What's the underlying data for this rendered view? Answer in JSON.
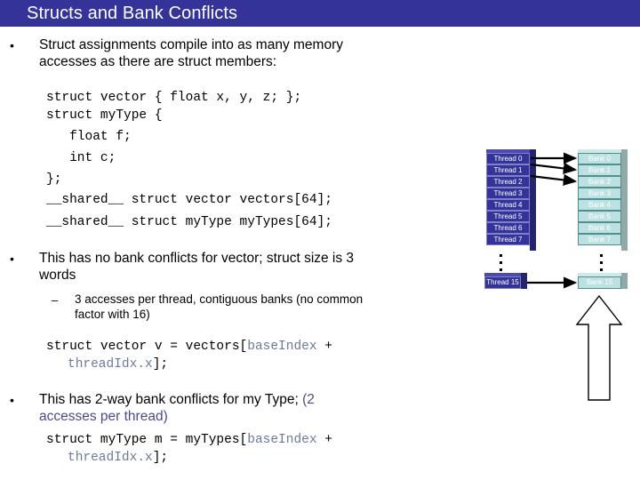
{
  "slide": {
    "title": "Structs and Bank Conflicts",
    "title_bg": "#333399",
    "title_color": "#ffffff",
    "background": "#ffffff"
  },
  "bullets": [
    {
      "marker": "•",
      "line1": "Struct assignments compile into as many memory",
      "line2": "accesses as there are struct members:"
    },
    {
      "marker": "•",
      "line1": "This has no bank conflicts for vector; struct size is 3",
      "line2": "words"
    },
    {
      "marker": "•",
      "line1_black": "This has 2-way bank conflicts for my Type; ",
      "line1_accent": "(2",
      "line2_accent": "accesses per thread)"
    }
  ],
  "sub_bullet": {
    "marker": "–",
    "line1": "3 accesses per thread, contiguous banks (no common",
    "line2": "factor with 16)"
  },
  "code_blocks": {
    "block1": {
      "line1": "struct vector { float x, y, z; };",
      "line2": "struct myType {",
      "line3": "   float f;",
      "line4": "   int c;",
      "line5": "};",
      "line6": "__shared__ struct vector vectors[64];",
      "line7": "__shared__ struct myType myTypes[64];"
    },
    "block2": {
      "line1_pre": "struct vector v = vectors[",
      "line1_var": "baseIndex",
      "line1_post": " +",
      "line2_var": "threadIdx.x",
      "line2_post": "];"
    },
    "block3": {
      "line1_pre": "struct myType m = myTypes[",
      "line1_var": "baseIndex",
      "line1_post": " +",
      "line2_var": "threadIdx.x",
      "line2_post": "];"
    }
  },
  "diagram": {
    "thread_color": "#33339a",
    "bank_color": "#bde0e0",
    "threads": [
      "Thread 0",
      "Thread 1",
      "Thread 2",
      "Thread 3",
      "Thread 4",
      "Thread 5",
      "Thread 6",
      "Thread 7"
    ],
    "banks": [
      "Bank 0",
      "Bank 1",
      "Bank 2",
      "Bank 3",
      "Bank 4",
      "Bank 5",
      "Bank 6",
      "Bank 7"
    ],
    "thread_last": "Thread 15",
    "bank_last": "Bank 15",
    "arrow_count": 3,
    "ellipsis": "⋮"
  }
}
